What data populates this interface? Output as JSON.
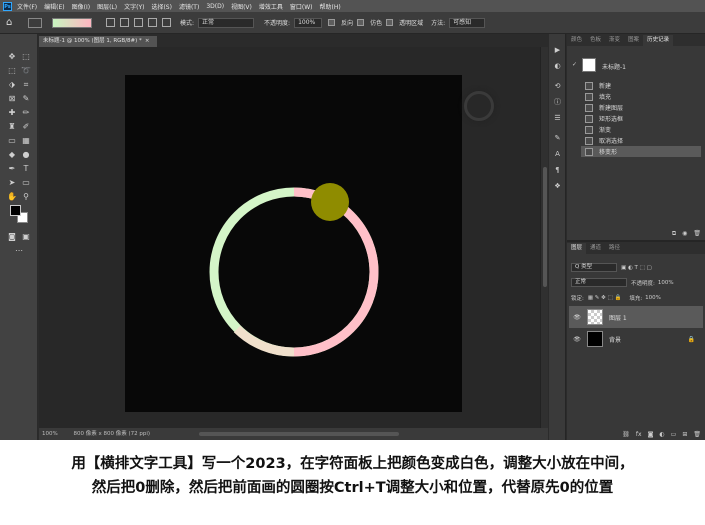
{
  "menubar": {
    "logo": "Ps",
    "items": [
      "文件(F)",
      "编辑(E)",
      "图像(I)",
      "图层(L)",
      "文字(Y)",
      "选择(S)",
      "滤镜(T)",
      "3D(D)",
      "视图(V)",
      "增效工具",
      "窗口(W)",
      "帮助(H)"
    ]
  },
  "options": {
    "mode_label": "模式:",
    "mode_value": "正常",
    "opacity_label": "不透明度:",
    "opacity_value": "100%",
    "reverse_label": "反向",
    "dither_label": "仿色",
    "transparency_label": "透明区域",
    "method_label": "方法:",
    "method_value": "可感知"
  },
  "document": {
    "tab_title": "未标题-1 @ 100% (图层 1, RGB/8#) *",
    "zoom": "100%",
    "size": "800 像素 x 800 像素 (72 ppi)"
  },
  "history_panel": {
    "tabs": [
      "颜色",
      "色板",
      "渐变",
      "图案",
      "历史记录"
    ],
    "snapshot_label": "未标题-1",
    "items": [
      "新建",
      "填充",
      "新建图层",
      "矩形选框",
      "渐变",
      "取消选择",
      "移变形"
    ]
  },
  "layers_panel": {
    "tabs": [
      "图层",
      "通道",
      "路径"
    ],
    "kind_label": "Q 类型",
    "blend_mode": "正常",
    "opacity_label": "不透明度:",
    "opacity_value": "100%",
    "lock_label": "锁定:",
    "fill_label": "填充:",
    "fill_value": "100%",
    "layers": [
      {
        "name": "图层 1"
      },
      {
        "name": "背景"
      }
    ]
  },
  "caption": {
    "line1": "用【横排文字工具】写一个2023，在字符面板上把颜色变成白色，调整大小放在中间，",
    "line2": "然后把0删除，然后把前面画的圆圈按Ctrl+T调整大小和位置，代替原先0的位置"
  },
  "colors": {
    "ring_green": "#d4f5c8",
    "ring_pink": "#ffc0c8",
    "ring_beige": "#f0e0cc",
    "yellow_dot": "#8f8c00",
    "workspace": "#282828"
  },
  "icons": [
    "home-icon",
    "move-icon",
    "marquee-icon",
    "lasso-icon",
    "crop-icon",
    "eyedropper-icon",
    "brush-icon",
    "eraser-icon",
    "gradient-icon",
    "pen-icon",
    "type-icon",
    "hand-icon",
    "zoom-icon",
    "eye-icon",
    "lock-icon",
    "trash-icon"
  ]
}
